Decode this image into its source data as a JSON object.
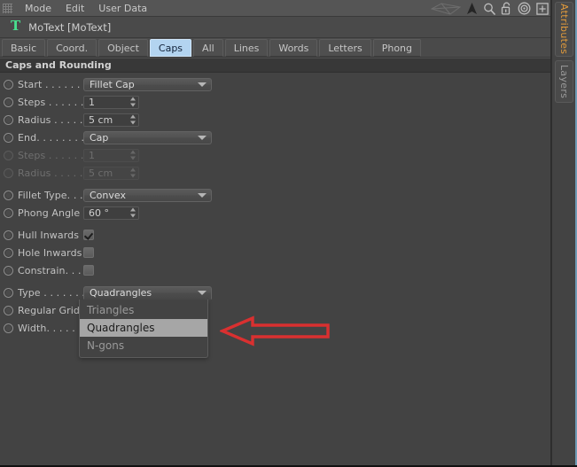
{
  "window": {
    "menu_items": [
      "Mode",
      "Edit",
      "User Data"
    ],
    "grip_icon": "drag-grip-icon",
    "toolbar_icons": [
      {
        "name": "mesh-shape-icon",
        "dim": true
      },
      {
        "name": "cursor-arrow-icon",
        "dim": false
      },
      {
        "name": "search-icon",
        "dim": false
      },
      {
        "name": "lock-open-icon",
        "dim": false
      },
      {
        "name": "target-icon",
        "dim": false
      },
      {
        "name": "add-box-icon",
        "dim": false
      }
    ]
  },
  "object_header": {
    "icon": "motext-t-icon",
    "icon_color": "#49e08e",
    "title": "MoText [MoText]"
  },
  "tabs": [
    {
      "label": "Basic",
      "active": false
    },
    {
      "label": "Coord.",
      "active": false
    },
    {
      "label": "Object",
      "active": false
    },
    {
      "label": "Caps",
      "active": true
    },
    {
      "label": "All",
      "active": false
    },
    {
      "label": "Lines",
      "active": false
    },
    {
      "label": "Words",
      "active": false
    },
    {
      "label": "Letters",
      "active": false
    },
    {
      "label": "Phong",
      "active": false
    }
  ],
  "group": {
    "title": "Caps and Rounding"
  },
  "params": [
    {
      "label": "Start . . . . . . .",
      "type": "combo",
      "value": "Fillet Cap",
      "enabled": true
    },
    {
      "label": "Steps . . . . . .",
      "type": "number",
      "value": "1",
      "enabled": true
    },
    {
      "label": "Radius . . . . .",
      "type": "number",
      "value": "5 cm",
      "enabled": true
    },
    {
      "label": "End. . . . . . . .",
      "type": "combo",
      "value": "Cap",
      "enabled": true
    },
    {
      "label": "Steps . . . . . .",
      "type": "number",
      "value": "1",
      "enabled": false
    },
    {
      "label": "Radius . . . . .",
      "type": "number",
      "value": "5 cm",
      "enabled": false
    },
    {
      "label": "Fillet Type. . .",
      "type": "combo",
      "value": "Convex",
      "enabled": true,
      "gap": true
    },
    {
      "label": "Phong Angle",
      "type": "number",
      "value": "60 °",
      "enabled": true
    },
    {
      "label": "Hull Inwards",
      "type": "check",
      "checked": true,
      "enabled": true,
      "gap": true
    },
    {
      "label": "Hole Inwards",
      "type": "check",
      "checked": false,
      "enabled": true
    },
    {
      "label": "Constrain. . .",
      "type": "check",
      "checked": false,
      "enabled": true
    },
    {
      "label": "Type . . . . . . .",
      "type": "combo",
      "value": "Quadrangles",
      "enabled": true,
      "open": true,
      "gap": true
    },
    {
      "label": "Regular Grid",
      "type": "hidden",
      "enabled": true
    },
    {
      "label": "Width. . . . . . .",
      "type": "hidden",
      "enabled": true
    }
  ],
  "dropdown": {
    "name": "type-dropdown-list",
    "options": [
      {
        "label": "Triangles",
        "selected": false
      },
      {
        "label": "Quadrangles",
        "selected": true
      },
      {
        "label": "N-gons",
        "selected": false
      }
    ]
  },
  "annotation": {
    "name": "red-arrow-pointing-left",
    "color": "#d93030",
    "points_to": "Quadrangles"
  },
  "rail": {
    "tabs": [
      {
        "label": "Attributes",
        "active": true,
        "color": "#e09a3c"
      },
      {
        "label": "Layers",
        "active": false,
        "color": "#9a9a9a"
      }
    ],
    "accent_color": "#6f9bb5"
  }
}
